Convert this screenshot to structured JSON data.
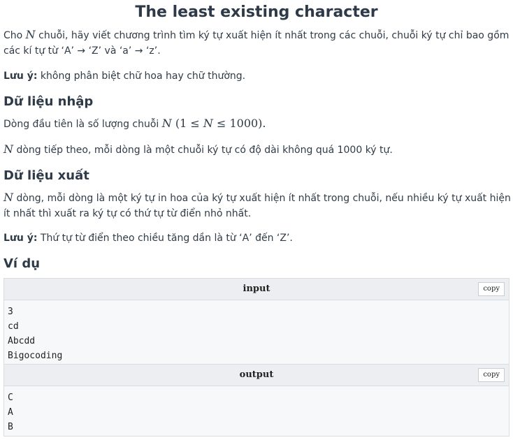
{
  "title": "The least existing character",
  "intro": {
    "p1_a": "Cho ",
    "p1_var": "N",
    "p1_b": " chuỗi, hãy viết chương trình tìm ký tự xuất hiện ít nhất trong các chuỗi, chuỗi ký tự chỉ bao gồm các kí tự từ ‘A’ → ‘Z’ và ‘a’ → ‘z’.",
    "note_label": "Lưu ý:",
    "note_text": " không phân biệt chữ hoa hay chữ thường."
  },
  "input_section": {
    "heading": "Dữ liệu nhập",
    "line1_a": "Dòng đầu tiên là số lượng chuỗi ",
    "line1_var": "N",
    "line1_math": " (1 ≤ ",
    "line1_var2": "N",
    "line1_math2": " ≤ 1000).",
    "line2_var": "N",
    "line2_text": " dòng tiếp theo, mỗi dòng là một chuỗi ký tự có độ dài không quá 1000 ký tự."
  },
  "output_section": {
    "heading": "Dữ liệu xuất",
    "line1_var": "N",
    "line1_text": " dòng, mỗi dòng là một ký tự in hoa của ký tự xuất hiện ít nhất trong chuỗi, nếu nhiều ký tự xuất hiện ít nhất thì xuất ra ký tự có thứ tự từ điển nhỏ nhất.",
    "note_label": "Lưu ý:",
    "note_text": " Thứ tự từ điển theo chiều tăng dần là từ ‘A’ đến ‘Z’."
  },
  "example": {
    "heading": "Ví dụ",
    "input_label": "input",
    "output_label": "output",
    "copy_label": "copy",
    "input_lines": [
      "3",
      "cd",
      "Abcdd",
      "Bigocoding"
    ],
    "output_lines": [
      "C",
      "A",
      "B"
    ]
  }
}
